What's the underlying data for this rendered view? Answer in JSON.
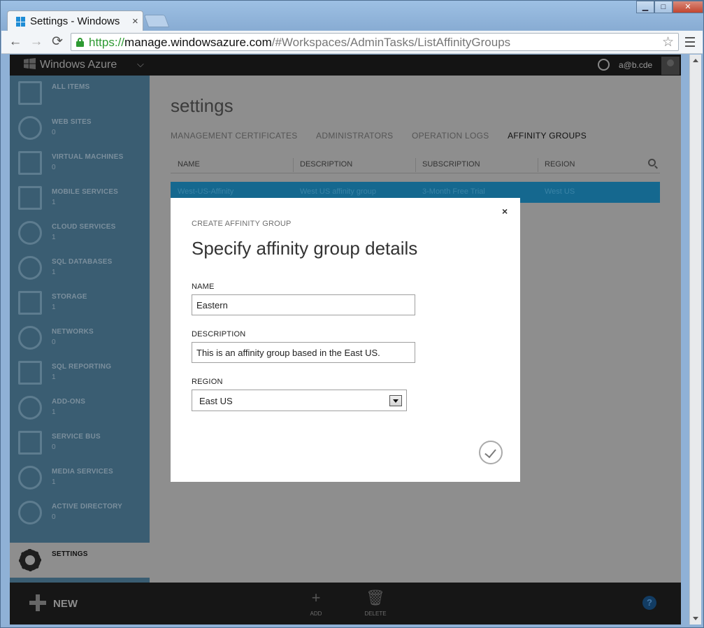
{
  "browser": {
    "tab_title": "Settings - Windows Azure",
    "tab_close": "×",
    "back_glyph": "←",
    "forward_glyph": "→",
    "reload_glyph": "⟳",
    "url_scheme": "https://",
    "url_host": "manage.windowsazure.com",
    "url_path": "/#Workspaces/AdminTasks/ListAffinityGroups",
    "bookmark_glyph": "☆",
    "min_glyph": "▁",
    "max_glyph": "□",
    "close_glyph": "✕"
  },
  "topbar": {
    "brand": "Windows Azure",
    "chevron": "⌵",
    "user": "a@b.cde"
  },
  "sidebar": {
    "items": [
      {
        "label": "ALL ITEMS",
        "count": ""
      },
      {
        "label": "WEB SITES",
        "count": "0"
      },
      {
        "label": "VIRTUAL MACHINES",
        "count": "0"
      },
      {
        "label": "MOBILE SERVICES",
        "count": "1"
      },
      {
        "label": "CLOUD SERVICES",
        "count": "1"
      },
      {
        "label": "SQL DATABASES",
        "count": "1"
      },
      {
        "label": "STORAGE",
        "count": "1"
      },
      {
        "label": "NETWORKS",
        "count": "0"
      },
      {
        "label": "SQL REPORTING",
        "count": "1"
      },
      {
        "label": "ADD-ONS",
        "count": "1"
      },
      {
        "label": "SERVICE BUS",
        "count": "0"
      },
      {
        "label": "MEDIA SERVICES",
        "count": "1"
      },
      {
        "label": "ACTIVE DIRECTORY",
        "count": "0"
      }
    ],
    "settings_label": "SETTINGS"
  },
  "main": {
    "title": "settings",
    "tabs": [
      "MANAGEMENT CERTIFICATES",
      "ADMINISTRATORS",
      "OPERATION LOGS",
      "AFFINITY GROUPS"
    ],
    "columns": [
      "NAME",
      "DESCRIPTION",
      "SUBSCRIPTION",
      "REGION"
    ],
    "row": {
      "name": "West-US-Affinity",
      "description": "West US affinity group",
      "subscription": "3-Month Free Trial",
      "region": "West US"
    }
  },
  "cmdbar": {
    "new_label": "NEW",
    "add_label": "ADD",
    "delete_label": "DELETE",
    "help_glyph": "?",
    "add_glyph": "+",
    "delete_glyph": "🗑"
  },
  "modal": {
    "close_glyph": "×",
    "subtitle": "CREATE AFFINITY GROUP",
    "title": "Specify affinity group details",
    "name_label": "NAME",
    "name_value": "Eastern",
    "description_label": "DESCRIPTION",
    "description_value": "This is an affinity group based in the East US.",
    "region_label": "REGION",
    "region_value": "East US"
  },
  "colors": {
    "accent": "#15688f",
    "sidebar": "#3a5d72",
    "overlay": "#8e8e8e"
  }
}
